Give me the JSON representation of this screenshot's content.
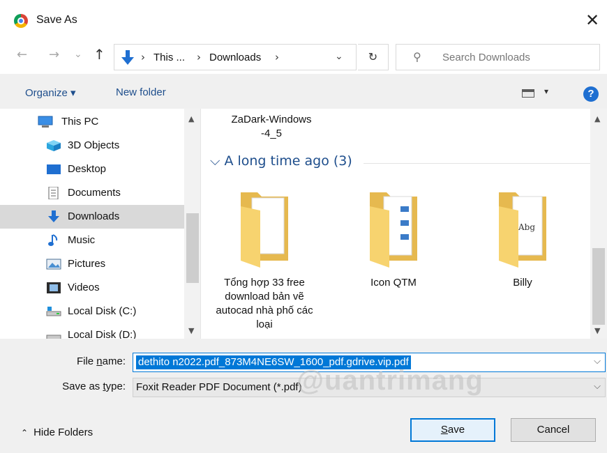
{
  "window": {
    "title": "Save As",
    "close_label": "✕"
  },
  "nav": {
    "back": "←",
    "forward": "→",
    "recent": "⌄",
    "up": "↑",
    "breadcrumb": [
      "This ...",
      "Downloads"
    ],
    "separators": [
      "›",
      "›",
      "›"
    ],
    "dropdown": "⌄",
    "refresh": "↻",
    "search_placeholder": "Search Downloads"
  },
  "toolbar": {
    "organize": "Organize ▾",
    "new_folder": "New folder",
    "view_dropdown": "▾",
    "help": "?"
  },
  "sidebar": {
    "items": [
      {
        "label": "This PC",
        "icon": "computer-icon"
      },
      {
        "label": "3D Objects",
        "icon": "cube-icon"
      },
      {
        "label": "Desktop",
        "icon": "desktop-icon"
      },
      {
        "label": "Documents",
        "icon": "document-icon"
      },
      {
        "label": "Downloads",
        "icon": "download-icon",
        "selected": true
      },
      {
        "label": "Music",
        "icon": "music-icon"
      },
      {
        "label": "Pictures",
        "icon": "picture-icon"
      },
      {
        "label": "Videos",
        "icon": "video-icon"
      },
      {
        "label": "Local Disk (C:)",
        "icon": "drive-icon"
      },
      {
        "label": "Local Disk (D:)",
        "icon": "drive-icon"
      }
    ],
    "scroll_up": "▲",
    "scroll_down": "▼"
  },
  "content": {
    "top_file": "ZaDark-Windows -4_5",
    "group_header": "⌵ A long time ago (3)",
    "folders": [
      {
        "name": "Tổng hợp 33 free download bản vẽ autocad nhà phố các loại"
      },
      {
        "name": "Icon QTM"
      },
      {
        "name": "Billy"
      }
    ],
    "billy_art_text": "Abg"
  },
  "form": {
    "file_name_label_pre": "File ",
    "file_name_label_u": "n",
    "file_name_label_post": "ame:",
    "file_name_value": "dethito                     n2022.pdf_873M4NE6SW_1600_pdf.gdrive.vip.pdf",
    "save_type_label_pre": "Save as ",
    "save_type_label_u": "t",
    "save_type_label_post": "ype:",
    "save_type_value": "Foxit Reader PDF Document (*.pdf)",
    "dropdown": "⌵"
  },
  "footer": {
    "hide_folders_chevron": "⌃",
    "hide_folders": "Hide Folders",
    "save_u": "S",
    "save_rest": "ave",
    "cancel": "Cancel"
  },
  "watermark": "@uantrimang"
}
